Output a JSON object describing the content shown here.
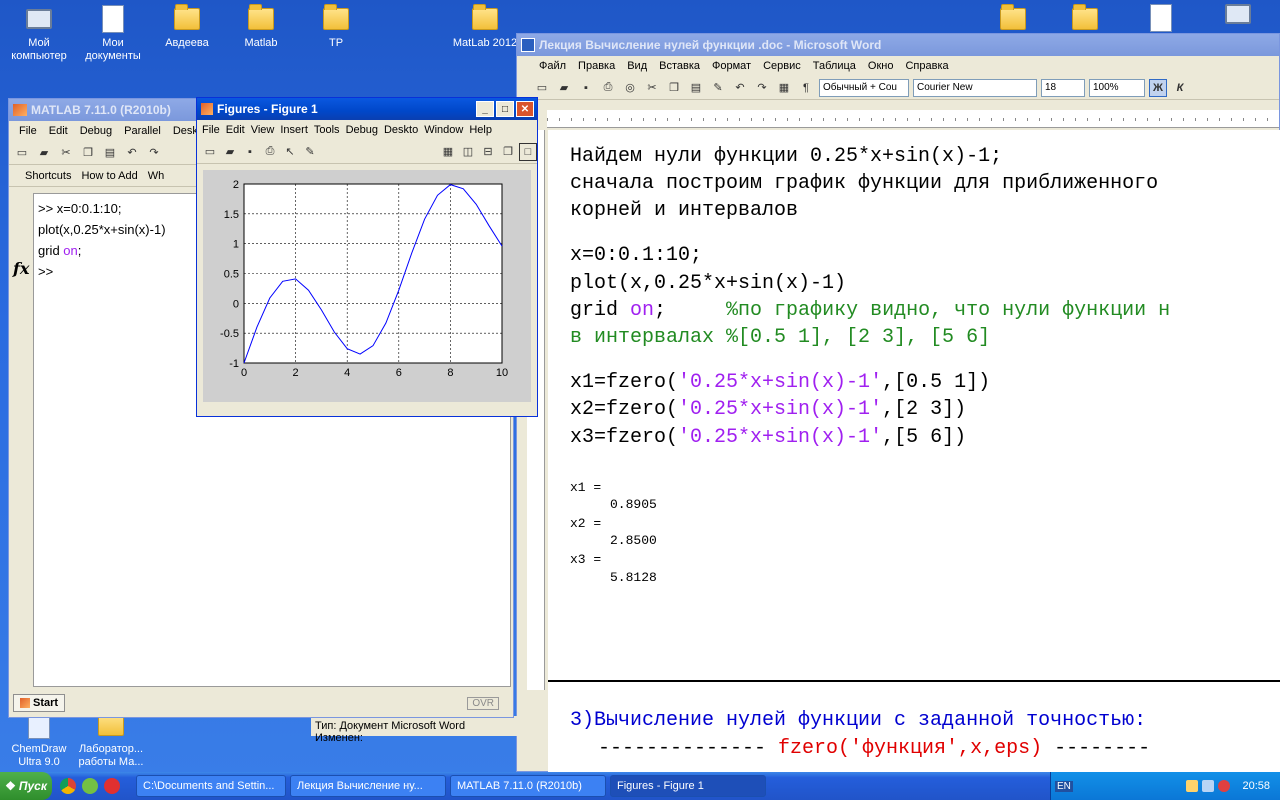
{
  "desktop_icons": [
    {
      "label": "Мой компьютер",
      "icon": "my-computer-icon"
    },
    {
      "label": "Мои документы",
      "icon": "my-documents-icon"
    },
    {
      "label": "Авдеева",
      "icon": "folder-icon"
    },
    {
      "label": "Matlab",
      "icon": "folder-icon"
    },
    {
      "label": "TP",
      "icon": "folder-icon"
    },
    {
      "label": "MatLab 2012",
      "icon": "folder-icon"
    },
    {
      "label": "ChemDraw Ultra 9.0",
      "icon": "chemdraw-icon"
    },
    {
      "label": "Лаборатор... работы Ма...",
      "icon": "folder-icon"
    }
  ],
  "matlab": {
    "title": "MATLAB 7.11.0 (R2010b)",
    "menu": [
      "File",
      "Edit",
      "Debug",
      "Parallel",
      "Deskto"
    ],
    "shortcuts": [
      "Shortcuts",
      "How to Add",
      "Wh"
    ],
    "command_lines": [
      ">> x=0:0.1:10;",
      "plot(x,0.25*x+sin(x)-1)",
      "grid ",
      "on",
      ";",
      ">>"
    ],
    "fx_label": "fx",
    "start_label": "Start",
    "ovr_label": "OVR"
  },
  "figure": {
    "title": "Figures - Figure 1",
    "menu": [
      "File",
      "Edit",
      "View",
      "Insert",
      "Tools",
      "Debug",
      "Deskto",
      "Window",
      "Help"
    ]
  },
  "chart_data": {
    "type": "line",
    "xlim": [
      0,
      10
    ],
    "ylim": [
      -1,
      2
    ],
    "xticks": [
      0,
      2,
      4,
      6,
      8,
      10
    ],
    "yticks": [
      -1,
      -0.5,
      0,
      0.5,
      1,
      1.5,
      2
    ],
    "xtick_labels": [
      "0",
      "2",
      "4",
      "6",
      "8",
      "10"
    ],
    "ytick_labels": [
      "-1",
      "-0.5",
      "0",
      "0.5",
      "1",
      "1.5",
      "2"
    ],
    "grid": true,
    "line_color": "#0000ff",
    "series": [
      {
        "x": [
          0,
          0.5,
          1,
          1.5,
          2,
          2.5,
          3,
          3.5,
          4,
          4.5,
          5,
          5.5,
          6,
          6.5,
          7,
          7.5,
          8,
          8.5,
          9,
          9.5,
          10
        ],
        "values": [
          -1.0,
          -0.4,
          0.09,
          0.37,
          0.41,
          0.22,
          -0.11,
          -0.48,
          -0.76,
          -0.85,
          -0.71,
          -0.33,
          0.22,
          0.84,
          1.41,
          1.81,
          1.99,
          1.92,
          1.66,
          1.3,
          0.96
        ]
      }
    ]
  },
  "word": {
    "title": "Лекция Вычисление нулей функции .doc - Microsoft Word",
    "menu": [
      "Файл",
      "Правка",
      "Вид",
      "Вставка",
      "Формат",
      "Сервис",
      "Таблица",
      "Окно",
      "Справка"
    ],
    "style_value": "Обычный + Cou",
    "font_value": "Courier New",
    "size_value": "18",
    "zoom_value": "100%",
    "bold_label": "Ж",
    "italic_label": "К",
    "status_text": "Тип: Документ Microsoft Word Изменен:",
    "doc": {
      "l1": "Найдем нули функции 0.25*x+sin(x)-1;",
      "l2": "сначала построим график функции для приближенного",
      "l3": "корней и интервалов",
      "c1": "x=0:0.1:10;",
      "c2": "plot(x,0.25*x+sin(x)-1)",
      "c3a": "grid ",
      "c3b": "on",
      "c3c": ";     ",
      "c3d": "%по графику видно, что нули функции н",
      "c4": "в интервалах %[0.5 1], [2 3], [5 6]",
      "f1a": "x1=fzero(",
      "f1b": "'0.25*x+sin(x)-1'",
      "f1c": ",[0.5 1])",
      "f2a": "x2=fzero(",
      "f2b": "'0.25*x+sin(x)-1'",
      "f2c": ",[2 3])",
      "f3a": "x3=fzero(",
      "f3b": "'0.25*x+sin(x)-1'",
      "f3c": ",[5 6])",
      "o1": "x1 =",
      "v1": "0.8905",
      "o2": "x2 =",
      "v2": "2.8500",
      "o3": "x3 =",
      "v3": "5.8128",
      "h3": "3)Вычисление нулей функции с заданной точностью:",
      "h4a": "-------------- ",
      "h4b": "fzero('функция',x,eps)",
      "h4c": " --------"
    }
  },
  "taskbar": {
    "start": "Пуск",
    "tasks": [
      "C:\\Documents and Settin...",
      "Лекция Вычисление ну...",
      "MATLAB 7.11.0 (R2010b)",
      "Figures - Figure 1"
    ],
    "lang": "EN",
    "clock": "20:58"
  }
}
